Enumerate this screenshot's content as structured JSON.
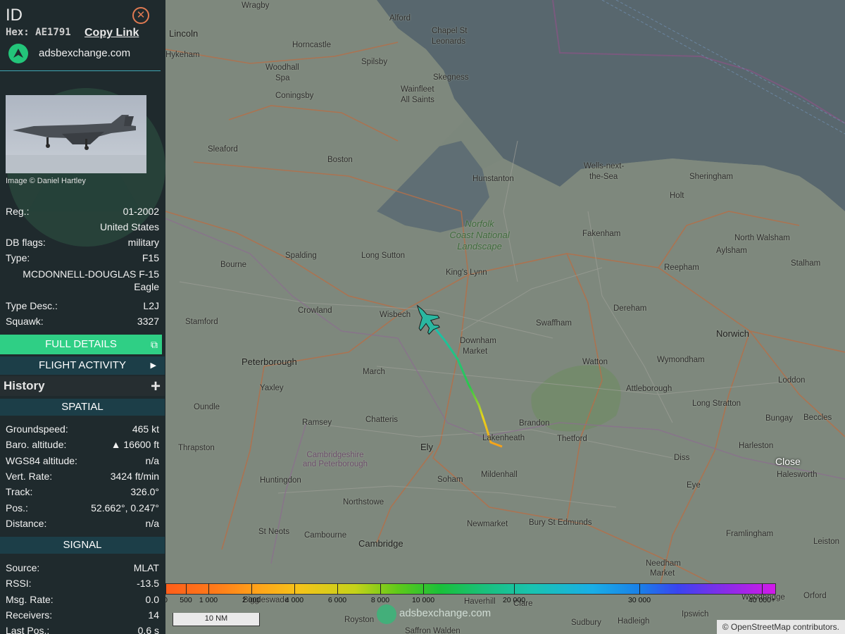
{
  "sidebar": {
    "title": "ID",
    "hex_line": "Hex: AE1791",
    "copy_link": "Copy Link",
    "source_site": "adsbexchange.com",
    "photo_credit": "Image © Daniel Hartley",
    "reg_label": "Reg.:",
    "reg_value": "01-2002",
    "country": "United States",
    "dbflags_label": "DB flags:",
    "dbflags_value": "military",
    "type_label": "Type:",
    "type_value": "F15",
    "type_full": "MCDONNELL-DOUGLAS F-15 Eagle",
    "typedesc_label": "Type Desc.:",
    "typedesc_value": "L2J",
    "squawk_label": "Squawk:",
    "squawk_value": "3327",
    "full_details": "FULL DETAILS",
    "flight_activity": "FLIGHT ACTIVITY",
    "history": "History",
    "spatial_header": "SPATIAL",
    "spatial": [
      {
        "label": "Groundspeed:",
        "value": "465 kt"
      },
      {
        "label": "Baro. altitude:",
        "value": "▲ 16600 ft"
      },
      {
        "label": "WGS84 altitude:",
        "value": "n/a"
      },
      {
        "label": "Vert. Rate:",
        "value": "3424 ft/min"
      },
      {
        "label": "Track:",
        "value": "326.0°"
      },
      {
        "label": "Pos.:",
        "value": "52.662°, 0.247°"
      },
      {
        "label": "Distance:",
        "value": "n/a"
      }
    ],
    "signal_header": "SIGNAL",
    "signal": [
      {
        "label": "Source:",
        "value": "MLAT"
      },
      {
        "label": "RSSI:",
        "value": "-13.5"
      },
      {
        "label": "Msg. Rate:",
        "value": "0.0"
      },
      {
        "label": "Receivers:",
        "value": "14"
      },
      {
        "label": "Last Pos.:",
        "value": "0.6 s"
      }
    ]
  },
  "map": {
    "places": {
      "wragby": "Wragby",
      "alford": "Alford",
      "lincoln": "Lincoln",
      "hykeham": "Hykeham",
      "horncastle": "Horncastle",
      "chapel": "Chapel St",
      "leonards": "Leonards",
      "spilsby": "Spilsby",
      "woodhall": "Woodhall",
      "spa": "Spa",
      "skegness": "Skegness",
      "wainfleet": "Wainfleet",
      "allsaints": "All Saints",
      "coningsby": "Coningsby",
      "sleaford": "Sleaford",
      "boston": "Boston",
      "hunstanton": "Hunstanton",
      "wells": "Wells-next-",
      "thesea": "the-Sea",
      "sheringham": "Sheringham",
      "holt": "Holt",
      "norfolk": "Norfolk",
      "coast": "Coast National",
      "landscape": "Landscape",
      "fakenham": "Fakenham",
      "northwalsham": "North Walsham",
      "aylsham": "Aylsham",
      "spalding": "Spalding",
      "longsutton": "Long Sutton",
      "bourne": "Bourne",
      "kingslynn": "King's Lynn",
      "reepham": "Reepham",
      "stalham": "Stalham",
      "crowland": "Crowland",
      "wisbech": "Wisbech",
      "dereham": "Dereham",
      "swaffham": "Swaffham",
      "stamford": "Stamford",
      "downham": "Downham",
      "market": "Market",
      "norwich": "Norwich",
      "peterborough": "Peterborough",
      "march": "March",
      "watton": "Watton",
      "wymondham": "Wymondham",
      "yaxley": "Yaxley",
      "attleborough": "Attleborough",
      "loddon": "Loddon",
      "oundle": "Oundle",
      "longstratton": "Long Stratton",
      "ramsey": "Ramsey",
      "chatteris": "Chatteris",
      "brandon": "Brandon",
      "bungay": "Bungay",
      "beccles": "Beccles",
      "lakenheath": "Lakenheath",
      "thetford": "Thetford",
      "thrapston": "Thrapston",
      "ely": "Ely",
      "harleston": "Harleston",
      "cambs": "Cambridgeshire",
      "andpeterborough": "and Peterborough",
      "diss": "Diss",
      "mildenhall": "Mildenhall",
      "huntingdon": "Huntingdon",
      "halesworth": "Halesworth",
      "soham": "Soham",
      "eye": "Eye",
      "northstowe": "Northstowe",
      "stneots": "St Neots",
      "framlingham": "Framlingham",
      "newmarket": "Newmarket",
      "buryste": "Bury St Edmunds",
      "cambourne": "Cambourne",
      "cambridge": "Cambridge",
      "leiston": "Leiston",
      "needham": "Needham",
      "needhammarket": "Market",
      "haverhill": "Haverhill",
      "clare": "Clare",
      "sudbury": "Sudbury",
      "hadleigh": "Hadleigh",
      "ipswich": "Ipswich",
      "royston": "Royston",
      "saffron": "Saffron Walden",
      "orford": "Orford",
      "woodbridge": "Woodbridge",
      "biggleswade": "Biggleswade"
    },
    "close": "Close",
    "altitude_scale": [
      "0",
      "500",
      "1 000",
      "2 000",
      "4 000",
      "6 000",
      "8 000",
      "10 000",
      "20 000",
      "30 000",
      "40 000+"
    ],
    "nm_scale": "10 NM",
    "watermark": "adsbexchange.com",
    "attribution": "© OpenStreetMap contributors."
  },
  "colors": {
    "accent": "#2fcf85",
    "section": "#1c3e48",
    "panel": "#1f2a2d"
  }
}
